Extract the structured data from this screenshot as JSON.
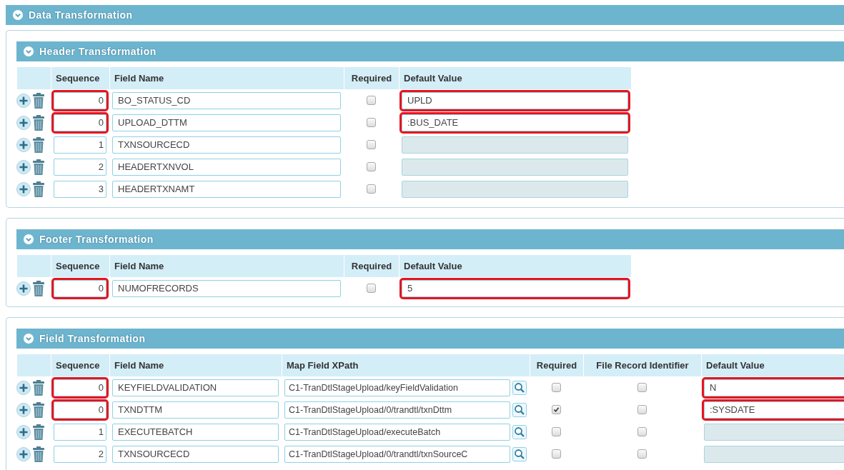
{
  "panel": {
    "title": "Data Transformation"
  },
  "sections": [
    {
      "title": "Header Transformation",
      "kind": "basic",
      "columns": [
        {
          "label": "Sequence",
          "kind": "sequence"
        },
        {
          "label": "Field Name",
          "kind": "text"
        },
        {
          "label": "Required",
          "kind": "check"
        },
        {
          "label": "Default Value",
          "kind": "default"
        }
      ],
      "rows": [
        {
          "cells": [
            {
              "text": "0",
              "highlighted": true
            },
            {
              "text": "BO_STATUS_CD"
            },
            {
              "checked": false
            },
            {
              "text": "UPLD",
              "disabled": false,
              "highlighted": true
            }
          ]
        },
        {
          "cells": [
            {
              "text": "0",
              "highlighted": true
            },
            {
              "text": "UPLOAD_DTTM"
            },
            {
              "checked": false
            },
            {
              "text": ":BUS_DATE",
              "disabled": false,
              "highlighted": true
            }
          ]
        },
        {
          "cells": [
            {
              "text": "1",
              "highlighted": false
            },
            {
              "text": "TXNSOURCECD"
            },
            {
              "checked": false
            },
            {
              "disabled": true,
              "highlighted": false
            }
          ]
        },
        {
          "cells": [
            {
              "text": "2",
              "highlighted": false
            },
            {
              "text": "HEADERTXNVOL"
            },
            {
              "checked": false
            },
            {
              "disabled": true,
              "highlighted": false
            }
          ]
        },
        {
          "cells": [
            {
              "text": "3",
              "highlighted": false
            },
            {
              "text": "HEADERTXNAMT"
            },
            {
              "checked": false
            },
            {
              "disabled": true,
              "highlighted": false
            }
          ]
        }
      ]
    },
    {
      "title": "Footer Transformation",
      "kind": "basic",
      "columns": [
        {
          "label": "Sequence",
          "kind": "sequence"
        },
        {
          "label": "Field Name",
          "kind": "text"
        },
        {
          "label": "Required",
          "kind": "check"
        },
        {
          "label": "Default Value",
          "kind": "default"
        }
      ],
      "rows": [
        {
          "cells": [
            {
              "text": "0",
              "highlighted": true
            },
            {
              "text": "NUMOFRECORDS"
            },
            {
              "checked": false
            },
            {
              "text": "5",
              "disabled": false,
              "highlighted": true
            }
          ]
        }
      ]
    },
    {
      "title": "Field Transformation",
      "kind": "mapped",
      "columns": [
        {
          "label": "Sequence",
          "kind": "sequence"
        },
        {
          "label": "Field Name",
          "kind": "text"
        },
        {
          "label": "Map Field XPath",
          "kind": "xpath"
        },
        {
          "label": "Required",
          "kind": "check"
        },
        {
          "label": "File Record Identifier",
          "kind": "check"
        },
        {
          "label": "Default Value",
          "kind": "default"
        }
      ],
      "rows": [
        {
          "cells": [
            {
              "text": "0",
              "highlighted": true
            },
            {
              "text": "KEYFIELDVALIDATION"
            },
            {
              "text": "C1-TranDtlStageUpload/keyFieldValidation"
            },
            {
              "checked": false
            },
            {
              "checked": false
            },
            {
              "text": "N",
              "disabled": false,
              "highlighted": true
            }
          ]
        },
        {
          "cells": [
            {
              "text": "0",
              "highlighted": true
            },
            {
              "text": "TXNDTTM"
            },
            {
              "text": "C1-TranDtlStageUpload/0/trandtl/txnDttm"
            },
            {
              "checked": true
            },
            {
              "checked": false
            },
            {
              "text": ":SYSDATE",
              "disabled": false,
              "highlighted": true
            }
          ]
        },
        {
          "cells": [
            {
              "text": "1",
              "highlighted": false
            },
            {
              "text": "EXECUTEBATCH"
            },
            {
              "text": "C1-TranDtlStageUpload/executeBatch"
            },
            {
              "checked": false
            },
            {
              "checked": false
            },
            {
              "disabled": true,
              "highlighted": false
            }
          ]
        },
        {
          "cells": [
            {
              "text": "2",
              "highlighted": false
            },
            {
              "text": "TXNSOURCECD"
            },
            {
              "text": "C1-TranDtlStageUpload/0/trandtl/txnSourceC"
            },
            {
              "checked": false
            },
            {
              "checked": false
            },
            {
              "disabled": true,
              "highlighted": false
            }
          ]
        }
      ]
    }
  ]
}
